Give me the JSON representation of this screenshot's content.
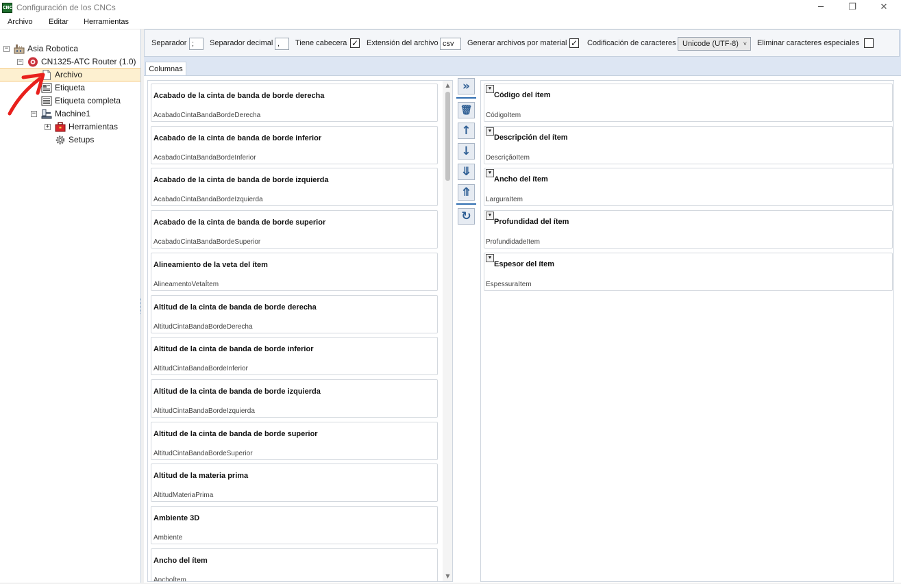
{
  "window": {
    "title": "Configuración de los CNCs",
    "icon_text": "CNC",
    "controls": [
      "minimize-icon",
      "restore-icon",
      "close-icon"
    ]
  },
  "menu": [
    "Archivo",
    "Editar",
    "Herramientas"
  ],
  "tree": {
    "root": "Asia Robotica",
    "machine": "CN1325-ATC Router (1.0)",
    "items": [
      "Archivo",
      "Etiqueta",
      "Etiqueta completa"
    ],
    "machine1": "Machine1",
    "tools": "Herramientas",
    "setups": "Setups",
    "selected": "Archivo"
  },
  "toolbar": {
    "separator_label": "Separador",
    "separator_value": ";",
    "decimal_label": "Separador decimal",
    "decimal_value": ",",
    "header_label": "Tiene cabecera",
    "header_checked": true,
    "extension_label": "Extensión del archivo",
    "extension_value": "csv",
    "per_material_label": "Generar archivos por material",
    "per_material_checked": true,
    "encoding_label": "Codificación de caracteres",
    "encoding_value": "Unicode (UTF-8)",
    "remove_special_label": "Eliminar caracteres especiales",
    "remove_special_checked": false
  },
  "tab": "Columnas",
  "available_columns": [
    {
      "title": "Acabado de la cinta de banda de borde derecha",
      "key": "AcabadoCintaBandaBordeDerecha"
    },
    {
      "title": "Acabado de la cinta de banda de borde inferior",
      "key": "AcabadoCintaBandaBordeInferior"
    },
    {
      "title": "Acabado de la cinta de banda de borde izquierda",
      "key": "AcabadoCintaBandaBordeIzquierda"
    },
    {
      "title": "Acabado de la cinta de banda de borde superior",
      "key": "AcabadoCintaBandaBordeSuperior"
    },
    {
      "title": "Alineamiento de la veta del ítem",
      "key": "AlineamentoVetaÍtem"
    },
    {
      "title": "Altitud de la cinta de banda de borde derecha",
      "key": "AltitudCintaBandaBordeDerecha"
    },
    {
      "title": "Altitud de la cinta de banda de borde inferior",
      "key": "AltitudCintaBandaBordeInferior"
    },
    {
      "title": "Altitud de la cinta de banda de borde izquierda",
      "key": "AltitudCintaBandaBordeIzquierda"
    },
    {
      "title": "Altitud de la cinta de banda de borde superior",
      "key": "AltitudCintaBandaBordeSuperior"
    },
    {
      "title": "Altitud de la materia prima",
      "key": "AltitudMateriaPrima"
    },
    {
      "title": "Ambiente 3D",
      "key": "Ambiente"
    },
    {
      "title": "Ancho del ítem",
      "key": "AnchoÍtem"
    }
  ],
  "action_buttons": [
    {
      "name": "add-all-button",
      "glyph": "»"
    },
    {
      "name": "delete-button",
      "glyph": "🗑"
    },
    {
      "name": "move-up-button",
      "glyph": "↑"
    },
    {
      "name": "move-down-button",
      "glyph": "↓"
    },
    {
      "name": "merge-button",
      "glyph": "⤋"
    },
    {
      "name": "split-button",
      "glyph": "⤊"
    },
    {
      "name": "refresh-button",
      "glyph": "↻"
    }
  ],
  "selected_columns": [
    {
      "title": "Código del ítem",
      "key": "CódigoItem"
    },
    {
      "title": "Descripción del ítem",
      "key": "DescriçãoItem"
    },
    {
      "title": "Ancho del ítem",
      "key": "LarguraItem"
    },
    {
      "title": "Profundidad del ítem",
      "key": "ProfundidadeItem"
    },
    {
      "title": "Espesor del ítem",
      "key": "EspessuraItem"
    }
  ],
  "colors": {
    "selection_bg": "#fdf0d0",
    "selection_border": "#f4c36c",
    "button_icon": "#2f5f94",
    "annotation_arrow": "#e8201c"
  }
}
